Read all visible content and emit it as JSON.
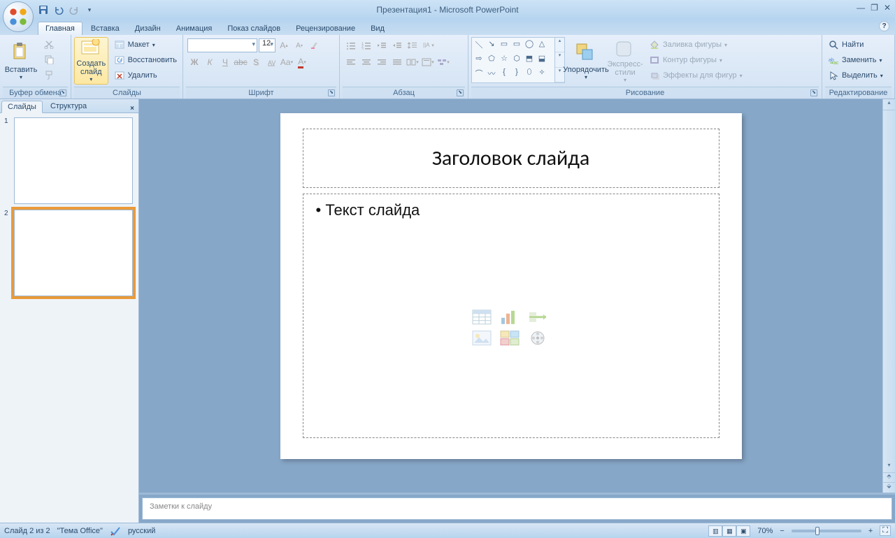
{
  "title": "Презентация1 - Microsoft PowerPoint",
  "tabs": [
    "Главная",
    "Вставка",
    "Дизайн",
    "Анимация",
    "Показ слайдов",
    "Рецензирование",
    "Вид"
  ],
  "active_tab": 0,
  "ribbon": {
    "clipboard": {
      "label": "Буфер обмена",
      "paste": "Вставить"
    },
    "slides": {
      "label": "Слайды",
      "new": "Создать\nслайд",
      "layout": "Макет",
      "reset": "Восстановить",
      "delete": "Удалить"
    },
    "font": {
      "label": "Шрифт",
      "size": "12"
    },
    "paragraph": {
      "label": "Абзац"
    },
    "drawing": {
      "label": "Рисование",
      "arrange": "Упорядочить",
      "quick": "Экспресс-стили",
      "fill": "Заливка фигуры",
      "outline": "Контур фигуры",
      "effects": "Эффекты для фигур"
    },
    "editing": {
      "label": "Редактирование",
      "find": "Найти",
      "replace": "Заменить",
      "select": "Выделить"
    }
  },
  "panel": {
    "tabs": [
      "Слайды",
      "Структура"
    ],
    "active": 0,
    "slides": [
      1,
      2
    ],
    "selected": 2
  },
  "slide": {
    "title": "Заголовок слайда",
    "body": "Текст слайда"
  },
  "notes_placeholder": "Заметки к слайду",
  "status": {
    "slide": "Слайд 2 из 2",
    "theme": "\"Тема Office\"",
    "lang": "русский",
    "zoom": "70%"
  }
}
